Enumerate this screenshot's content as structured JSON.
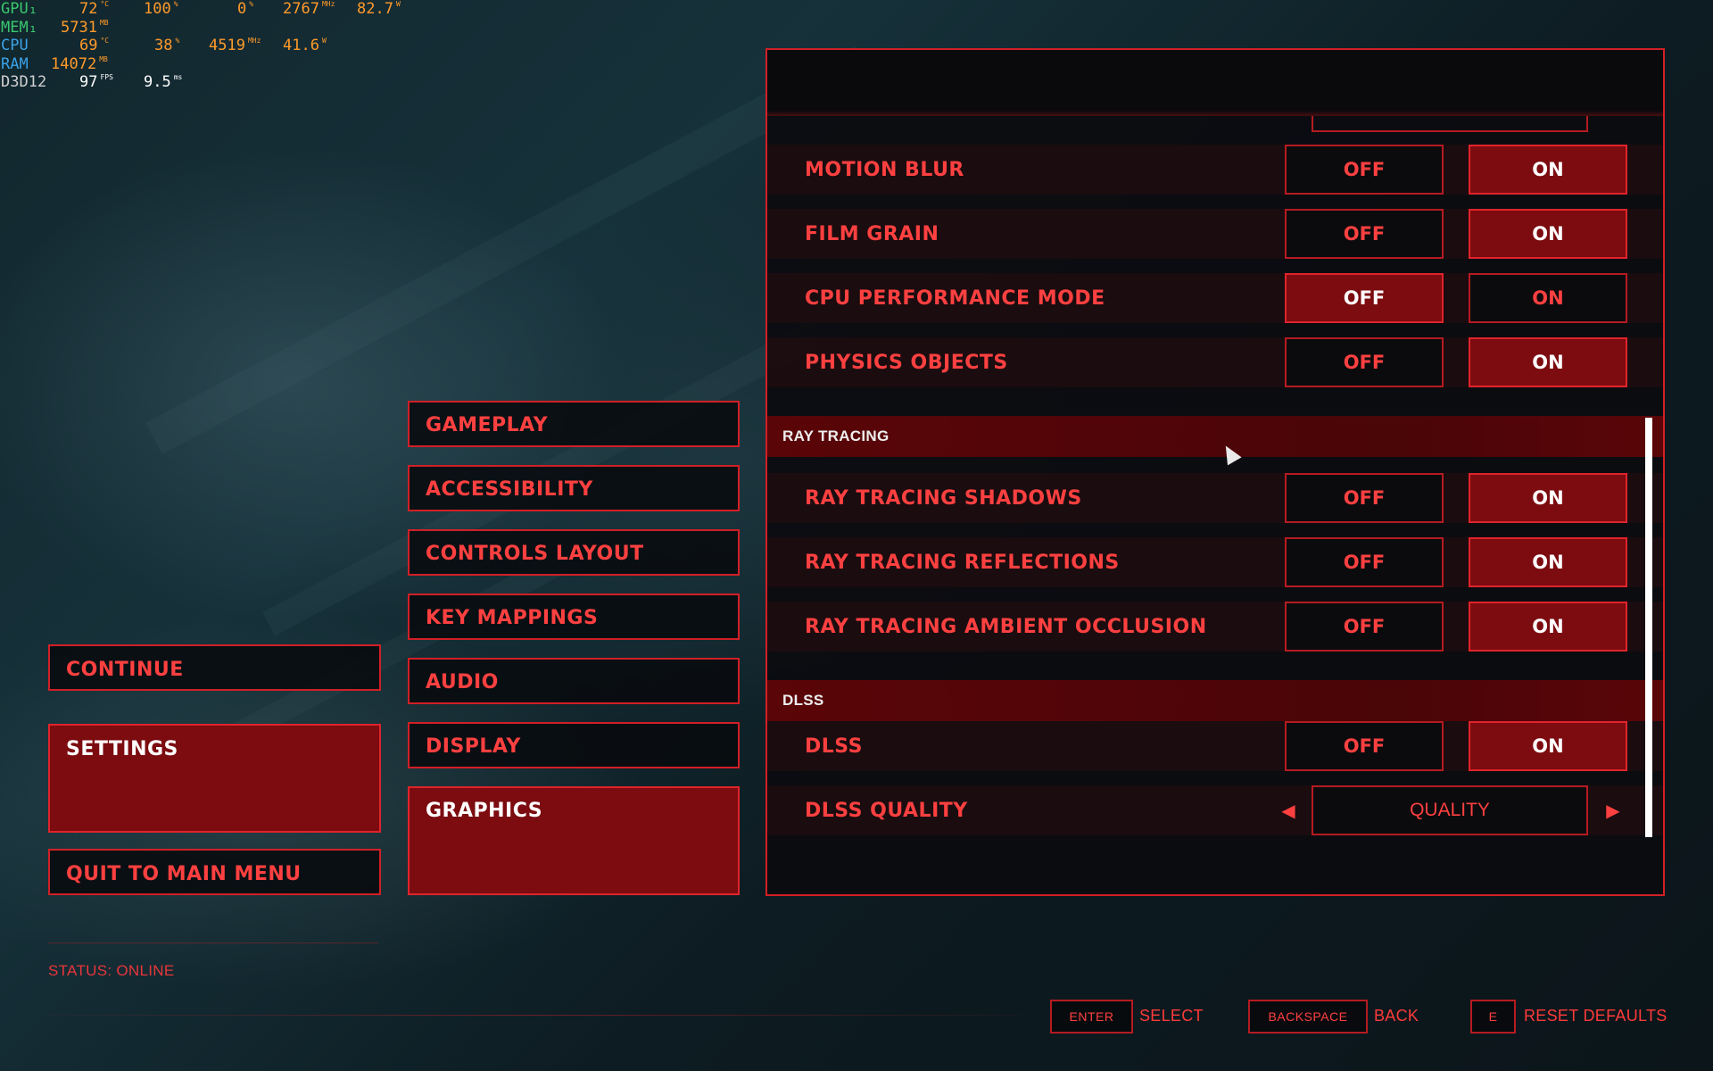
{
  "hw_overlay": {
    "gpu": {
      "label": "GPU₁",
      "temp": "72",
      "temp_unit": "°C",
      "load": "100",
      "load_unit": "%",
      "load2": "0",
      "load2_unit": "%",
      "clock": "2767",
      "clock_unit": "MHz",
      "power": "82.7",
      "power_unit": "W"
    },
    "mem": {
      "label": "MEM₁",
      "value": "5731",
      "unit": "MB"
    },
    "cpu": {
      "label": "CPU",
      "temp": "69",
      "temp_unit": "°C",
      "load": "38",
      "load_unit": "%",
      "clock": "4519",
      "clock_unit": "MHz",
      "power": "41.6",
      "power_unit": "W"
    },
    "ram": {
      "label": "RAM",
      "value": "14072",
      "unit": "MB"
    },
    "d3d": {
      "label": "D3D12",
      "fps": "97",
      "fps_unit": "FPS",
      "frametime": "9.5",
      "frametime_unit": "ms"
    }
  },
  "main_menu": [
    {
      "label": "CONTINUE"
    },
    {
      "label": "SETTINGS",
      "active": true
    },
    {
      "label": "QUIT TO MAIN MENU"
    }
  ],
  "categories": [
    {
      "label": "GAMEPLAY"
    },
    {
      "label": "ACCESSIBILITY"
    },
    {
      "label": "CONTROLS LAYOUT"
    },
    {
      "label": "KEY MAPPINGS"
    },
    {
      "label": "AUDIO"
    },
    {
      "label": "DISPLAY"
    },
    {
      "label": "GRAPHICS",
      "active": true
    }
  ],
  "status": "STATUS: ONLINE",
  "toggle_labels": {
    "off": "OFF",
    "on": "ON"
  },
  "settings": {
    "motion_blur": {
      "label": "MOTION BLUR",
      "value": "ON"
    },
    "film_grain": {
      "label": "FILM GRAIN",
      "value": "ON"
    },
    "cpu_performance_mode": {
      "label": "CPU PERFORMANCE MODE",
      "value": "OFF"
    },
    "physics_objects": {
      "label": "PHYSICS OBJECTS",
      "value": "ON"
    },
    "section_ray_tracing": "RAY TRACING",
    "rt_shadows": {
      "label": "RAY TRACING SHADOWS",
      "value": "ON"
    },
    "rt_reflections": {
      "label": "RAY TRACING REFLECTIONS",
      "value": "ON"
    },
    "rt_ao": {
      "label": "RAY TRACING AMBIENT OCCLUSION",
      "value": "ON"
    },
    "section_dlss": "DLSS",
    "dlss": {
      "label": "DLSS",
      "value": "ON"
    },
    "dlss_quality": {
      "label": "DLSS QUALITY",
      "value": "QUALITY"
    }
  },
  "hints": {
    "enter_key": "ENTER",
    "enter_action": "SELECT",
    "backspace_key": "BACKSPACE",
    "backspace_action": "BACK",
    "e_key": "E",
    "e_action": "RESET DEFAULTS"
  },
  "colors": {
    "accent": "#d21f26",
    "active_fill": "#7c0c10",
    "section_fill": "#5a0508"
  }
}
